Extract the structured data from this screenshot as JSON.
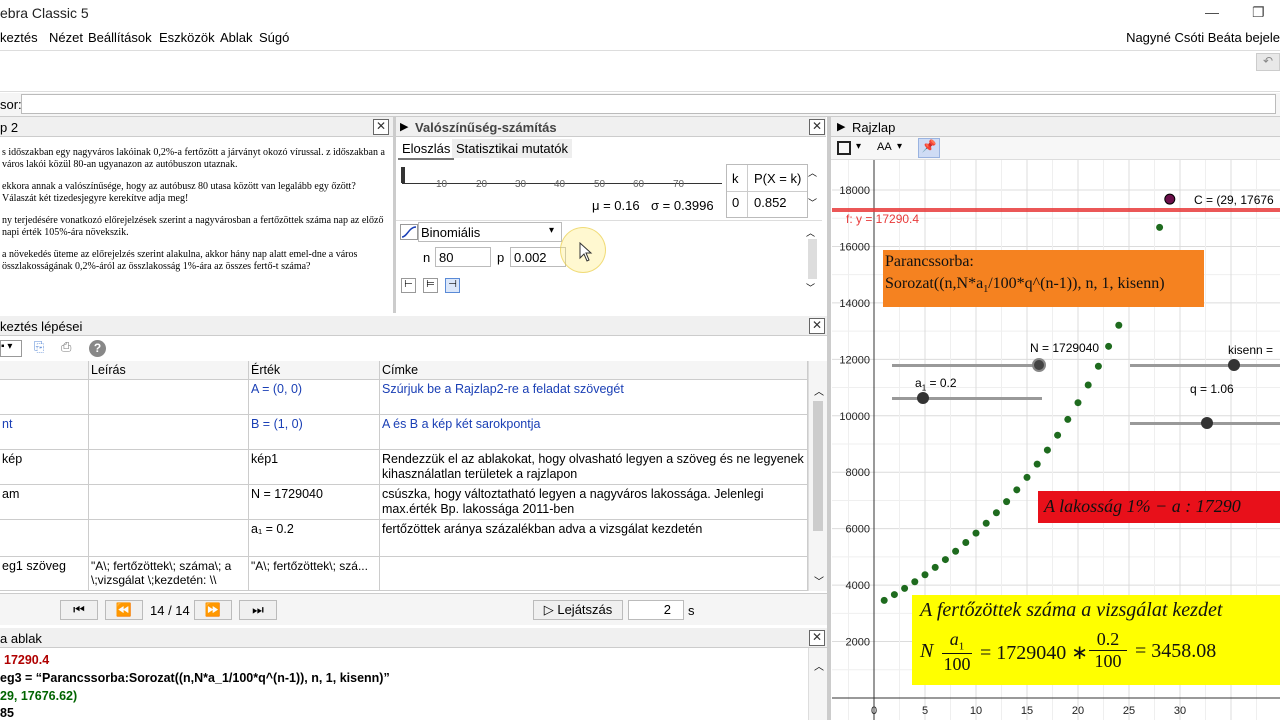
{
  "app": {
    "title": "ebra Classic 5",
    "window_minimize": "—",
    "window_restore": "❐",
    "user": "Nagyné Csóti Beáta bejele"
  },
  "menu": [
    "keztés",
    "Nézet",
    "Beállítások",
    "Eszközök",
    "Ablak",
    "Súgó"
  ],
  "input_bar": {
    "label": "sor:",
    "value": ""
  },
  "text_panel": {
    "title": "p 2",
    "paragraphs": [
      "s időszakban egy nagyváros lakóinak 0,2%-a fertőzött a járványt okozó vírussal. z időszakban a város lakói közül 80-an ugyanazon az autóbuszon utaznak.",
      "ekkora annak a valószínűsége, hogy az autóbusz 80 utasa között van legalább egy őzött? Válaszát két tizedesjegyre kerekítve adja meg!",
      "ny terjedésére vonatkozó előrejelzések szerint a nagyvárosban a fertőzöttek száma nap az előző napi érték 105%-ára növekszik.",
      "a növekedés üteme az előrejelzés szerint alakulna, akkor hány nap alatt emel-dne a város összlakosságának 0,2%-áról az összlakosság 1%-ára az összes fertő-t száma?"
    ]
  },
  "probability": {
    "title": "Valószínűség-számítás",
    "tabs": [
      "Eloszlás",
      "Statisztikai mutatók"
    ],
    "axis_ticks": [
      "10",
      "20",
      "30",
      "40",
      "50",
      "60",
      "70"
    ],
    "mu": "μ = 0.16",
    "sigma": "σ = 0.3996",
    "table_headers": [
      "k",
      "P(X = k)"
    ],
    "table_row": [
      "0",
      "0.852"
    ],
    "distribution": "Binomiális",
    "n_label": "n",
    "n_value": "80",
    "p_label": "p",
    "p_value": "0.002"
  },
  "construction": {
    "title": "keztés lépései",
    "columns": [
      "",
      "Leírás",
      "Érték",
      "Címke"
    ],
    "rows": [
      {
        "name": "",
        "desc": "",
        "value": "A = (0, 0)",
        "caption": "Szúrjuk be a Rajzlap2-re a feladat szövegét",
        "caption_blue": true
      },
      {
        "name": "nt",
        "desc": "",
        "value": "B = (1, 0)",
        "caption": "A és B a kép két sarokpontja",
        "caption_blue": true
      },
      {
        "name": "kép",
        "desc": "",
        "value": "kép1",
        "caption": "Rendezzük el az ablakokat, hogy olvasható legyen a szöveg és ne legyenek kihasználatlan területek a rajzlapon",
        "caption_blue": false
      },
      {
        "name": "am",
        "desc": "",
        "value": "N = 1729040",
        "caption": "csúszka, hogy változtatható legyen a nagyváros lakossága. Jelenlegi max.érték Bp. lakossága 2011-ben",
        "caption_blue": false
      },
      {
        "name": "",
        "desc": "",
        "value": "a₁ = 0.2",
        "caption": "fertőzöttek aránya százalékban adva a vizsgálat kezdetén",
        "caption_blue": false
      },
      {
        "name": "eg1 szöveg",
        "desc": "\"A\\; fertőzöttek\\; száma\\; a \\;vizsgálat \\;kezdetén: \\\\",
        "value": "\"A\\; fertőzöttek\\; szá...",
        "caption": "",
        "caption_blue": false
      }
    ],
    "nav": {
      "position": "14 / 14",
      "play": "▷ Lejátszás",
      "delay": "2",
      "unit": "s"
    }
  },
  "algebra": {
    "title": "a ablak",
    "lines": [
      {
        "text": "17290.4",
        "color": "#b00000"
      },
      {
        "text": "eg3 = “Parancssorba:Sorozat((n,N*a_1/100*q^(n-1)), n, 1, kisenn)”",
        "color": "#000000"
      },
      {
        "text": "29, 17676.62)",
        "color": "#006400"
      },
      {
        "text": "85",
        "color": "#000000"
      }
    ]
  },
  "graphics": {
    "title": "Rajzlap",
    "style_label": "AA",
    "y_ticks": [
      "18000",
      "16000",
      "14000",
      "12000",
      "10000",
      "8000",
      "6000",
      "4000",
      "2000"
    ],
    "x_ticks": [
      "0",
      "5",
      "10",
      "15",
      "20",
      "25",
      "30"
    ],
    "line_label": "f: y = 17290.4",
    "point_label": "C = (29, 17676",
    "orange_box": {
      "line1": "Parancssorba:",
      "line2": "Sorozat((n,N*a",
      "sub": "1",
      "line2b": "/100*q^(n-1)), n, 1, kisenn)"
    },
    "slider_N": "N = 1729040",
    "slider_a": "a",
    "slider_a_sub": "1",
    "slider_a_val": " = 0.2",
    "slider_kisenn": "kisenn =",
    "slider_q": "q = 1.06",
    "red_box": "A lakosság 1% − a :  17290",
    "yellow_box": {
      "line1": "A fertőzöttek száma a vizsgálat kezdet",
      "N": "N",
      "frac1_num": "a",
      "frac1_sub": "1",
      "frac1_den": "100",
      "eq1": "= 1729040 ∗",
      "frac2_num": "0.2",
      "frac2_den": "100",
      "eq2": "= 3458.08"
    },
    "colors": {
      "line": "#e83a3a",
      "points": "#1e6b1e",
      "point_c": "#6b0f4a",
      "orange": "#f58220",
      "red_box": "#e8101a",
      "yellow": "#ffff00"
    }
  },
  "chart_data": {
    "type": "scatter",
    "title": "",
    "xlabel": "",
    "ylabel": "",
    "xlim": [
      -1,
      39
    ],
    "ylim": [
      -1500,
      19000
    ],
    "x": [
      1,
      2,
      3,
      4,
      5,
      6,
      7,
      8,
      9,
      10,
      11,
      12,
      13,
      14,
      15,
      16,
      17,
      18,
      19,
      20,
      21,
      22,
      23,
      24,
      25,
      26,
      27,
      28
    ],
    "y": [
      3458,
      3665,
      3885,
      4119,
      4366,
      4628,
      4905,
      5200,
      5511,
      5842,
      6193,
      6564,
      6958,
      7376,
      7818,
      8288,
      8785,
      9312,
      9871,
      10463,
      11091,
      11756,
      12461,
      13209,
      14001,
      14841,
      15732,
      16676
    ],
    "series": [
      {
        "name": "",
        "values": []
      }
    ]
  }
}
